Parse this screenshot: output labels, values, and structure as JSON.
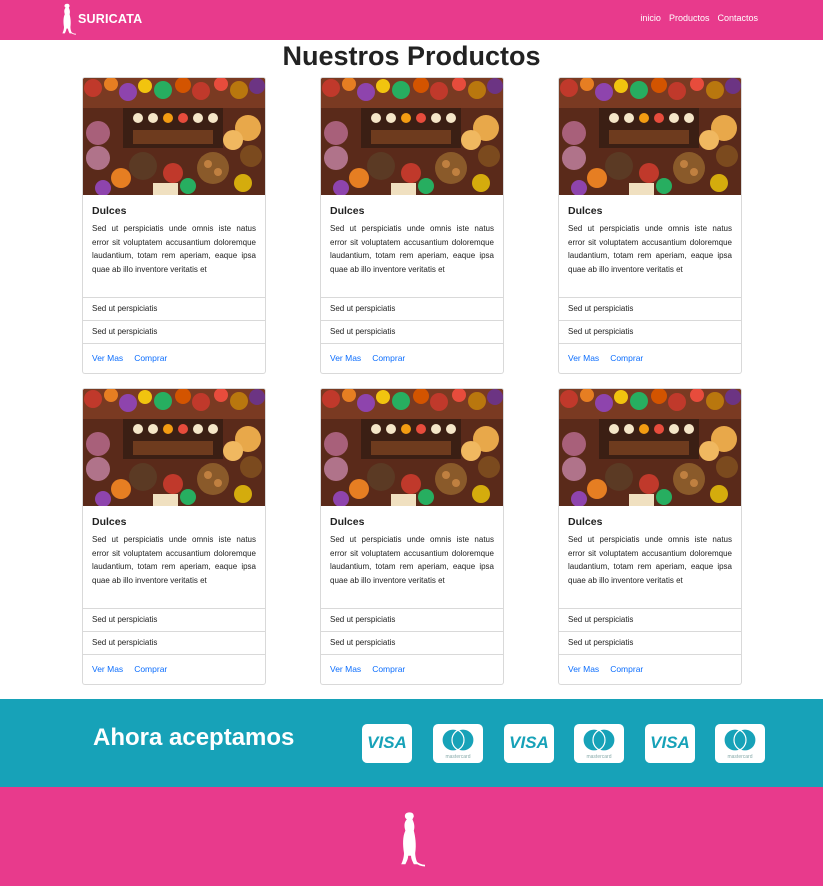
{
  "brand": {
    "name": "SURICATA",
    "logo_icon": "meerkat-icon"
  },
  "nav": {
    "items": [
      {
        "label": "inicio"
      },
      {
        "label": "Productos"
      },
      {
        "label": "Contactos"
      }
    ]
  },
  "page": {
    "title": "Nuestros Productos"
  },
  "products": [
    {
      "title": "Dulces",
      "text": "Sed ut perspiciatis unde omnis iste natus error sit voluptatem accusantium doloremque laudantium, totam rem aperiam, eaque ipsa quae ab illo inventore veritatis et",
      "list": [
        "Sed ut perspiciatis",
        "Sed ut perspiciatis"
      ],
      "links": {
        "more": "Ver Mas",
        "buy": "Comprar"
      }
    },
    {
      "title": "Dulces",
      "text": "Sed ut perspiciatis unde omnis iste natus error sit voluptatem accusantium doloremque laudantium, totam rem aperiam, eaque ipsa quae ab illo inventore veritatis et",
      "list": [
        "Sed ut perspiciatis",
        "Sed ut perspiciatis"
      ],
      "links": {
        "more": "Ver Mas",
        "buy": "Comprar"
      }
    },
    {
      "title": "Dulces",
      "text": "Sed ut perspiciatis unde omnis iste natus error sit voluptatem accusantium doloremque laudantium, totam rem aperiam, eaque ipsa quae ab illo inventore veritatis et",
      "list": [
        "Sed ut perspiciatis",
        "Sed ut perspiciatis"
      ],
      "links": {
        "more": "Ver Mas",
        "buy": "Comprar"
      }
    },
    {
      "title": "Dulces",
      "text": "Sed ut perspiciatis unde omnis iste natus error sit voluptatem accusantium doloremque laudantium, totam rem aperiam, eaque ipsa quae ab illo inventore veritatis et",
      "list": [
        "Sed ut perspiciatis",
        "Sed ut perspiciatis"
      ],
      "links": {
        "more": "Ver Mas",
        "buy": "Comprar"
      }
    },
    {
      "title": "Dulces",
      "text": "Sed ut perspiciatis unde omnis iste natus error sit voluptatem accusantium doloremque laudantium, totam rem aperiam, eaque ipsa quae ab illo inventore veritatis et",
      "list": [
        "Sed ut perspiciatis",
        "Sed ut perspiciatis"
      ],
      "links": {
        "more": "Ver Mas",
        "buy": "Comprar"
      }
    },
    {
      "title": "Dulces",
      "text": "Sed ut perspiciatis unde omnis iste natus error sit voluptatem accusantium doloremque laudantium, totam rem aperiam, eaque ipsa quae ab illo inventore veritatis et",
      "list": [
        "Sed ut perspiciatis",
        "Sed ut perspiciatis"
      ],
      "links": {
        "more": "Ver Mas",
        "buy": "Comprar"
      }
    }
  ],
  "payments": {
    "title": "Ahora aceptamos",
    "cards": [
      {
        "type": "visa",
        "label": "VISA"
      },
      {
        "type": "mastercard",
        "label": "mastercard"
      },
      {
        "type": "visa",
        "label": "VISA"
      },
      {
        "type": "mastercard",
        "label": "mastercard"
      },
      {
        "type": "visa",
        "label": "VISA"
      },
      {
        "type": "mastercard",
        "label": "mastercard"
      }
    ]
  },
  "colors": {
    "primary": "#e83a8c",
    "accent": "#17a2b8",
    "link": "#0d6efd"
  },
  "footer": {
    "logo_icon": "meerkat-icon"
  }
}
